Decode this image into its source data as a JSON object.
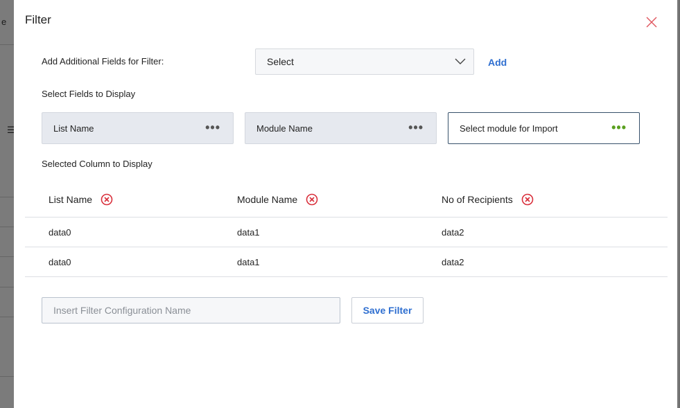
{
  "background": {
    "partial_text": "e"
  },
  "dialog": {
    "title": "Filter",
    "close_icon": "close-icon"
  },
  "additional_fields": {
    "label": "Add Additional Fields for Filter:",
    "select_value": "Select",
    "add_label": "Add"
  },
  "display_fields": {
    "label": "Select Fields to Display",
    "cards": [
      {
        "label": "List Name",
        "active": false
      },
      {
        "label": "Module Name",
        "active": false
      },
      {
        "label": "Select module for Import",
        "active": true
      }
    ],
    "more_icon": "more-horizontal-icon"
  },
  "selected_columns": {
    "label": "Selected Column to Display",
    "headers": [
      "List Name",
      "Module Name",
      "No of Recipients"
    ],
    "rows": [
      [
        "data0",
        "data1",
        "data2"
      ],
      [
        "data0",
        "data1",
        "data2"
      ]
    ]
  },
  "save": {
    "name_placeholder": "Insert Filter Configuration Name",
    "name_value": "",
    "button_label": "Save Filter"
  },
  "colors": {
    "accent": "#2f6fd0",
    "remove": "#d9303c",
    "active_dots": "#5aa01f",
    "card_bg": "#e6e9ef"
  }
}
